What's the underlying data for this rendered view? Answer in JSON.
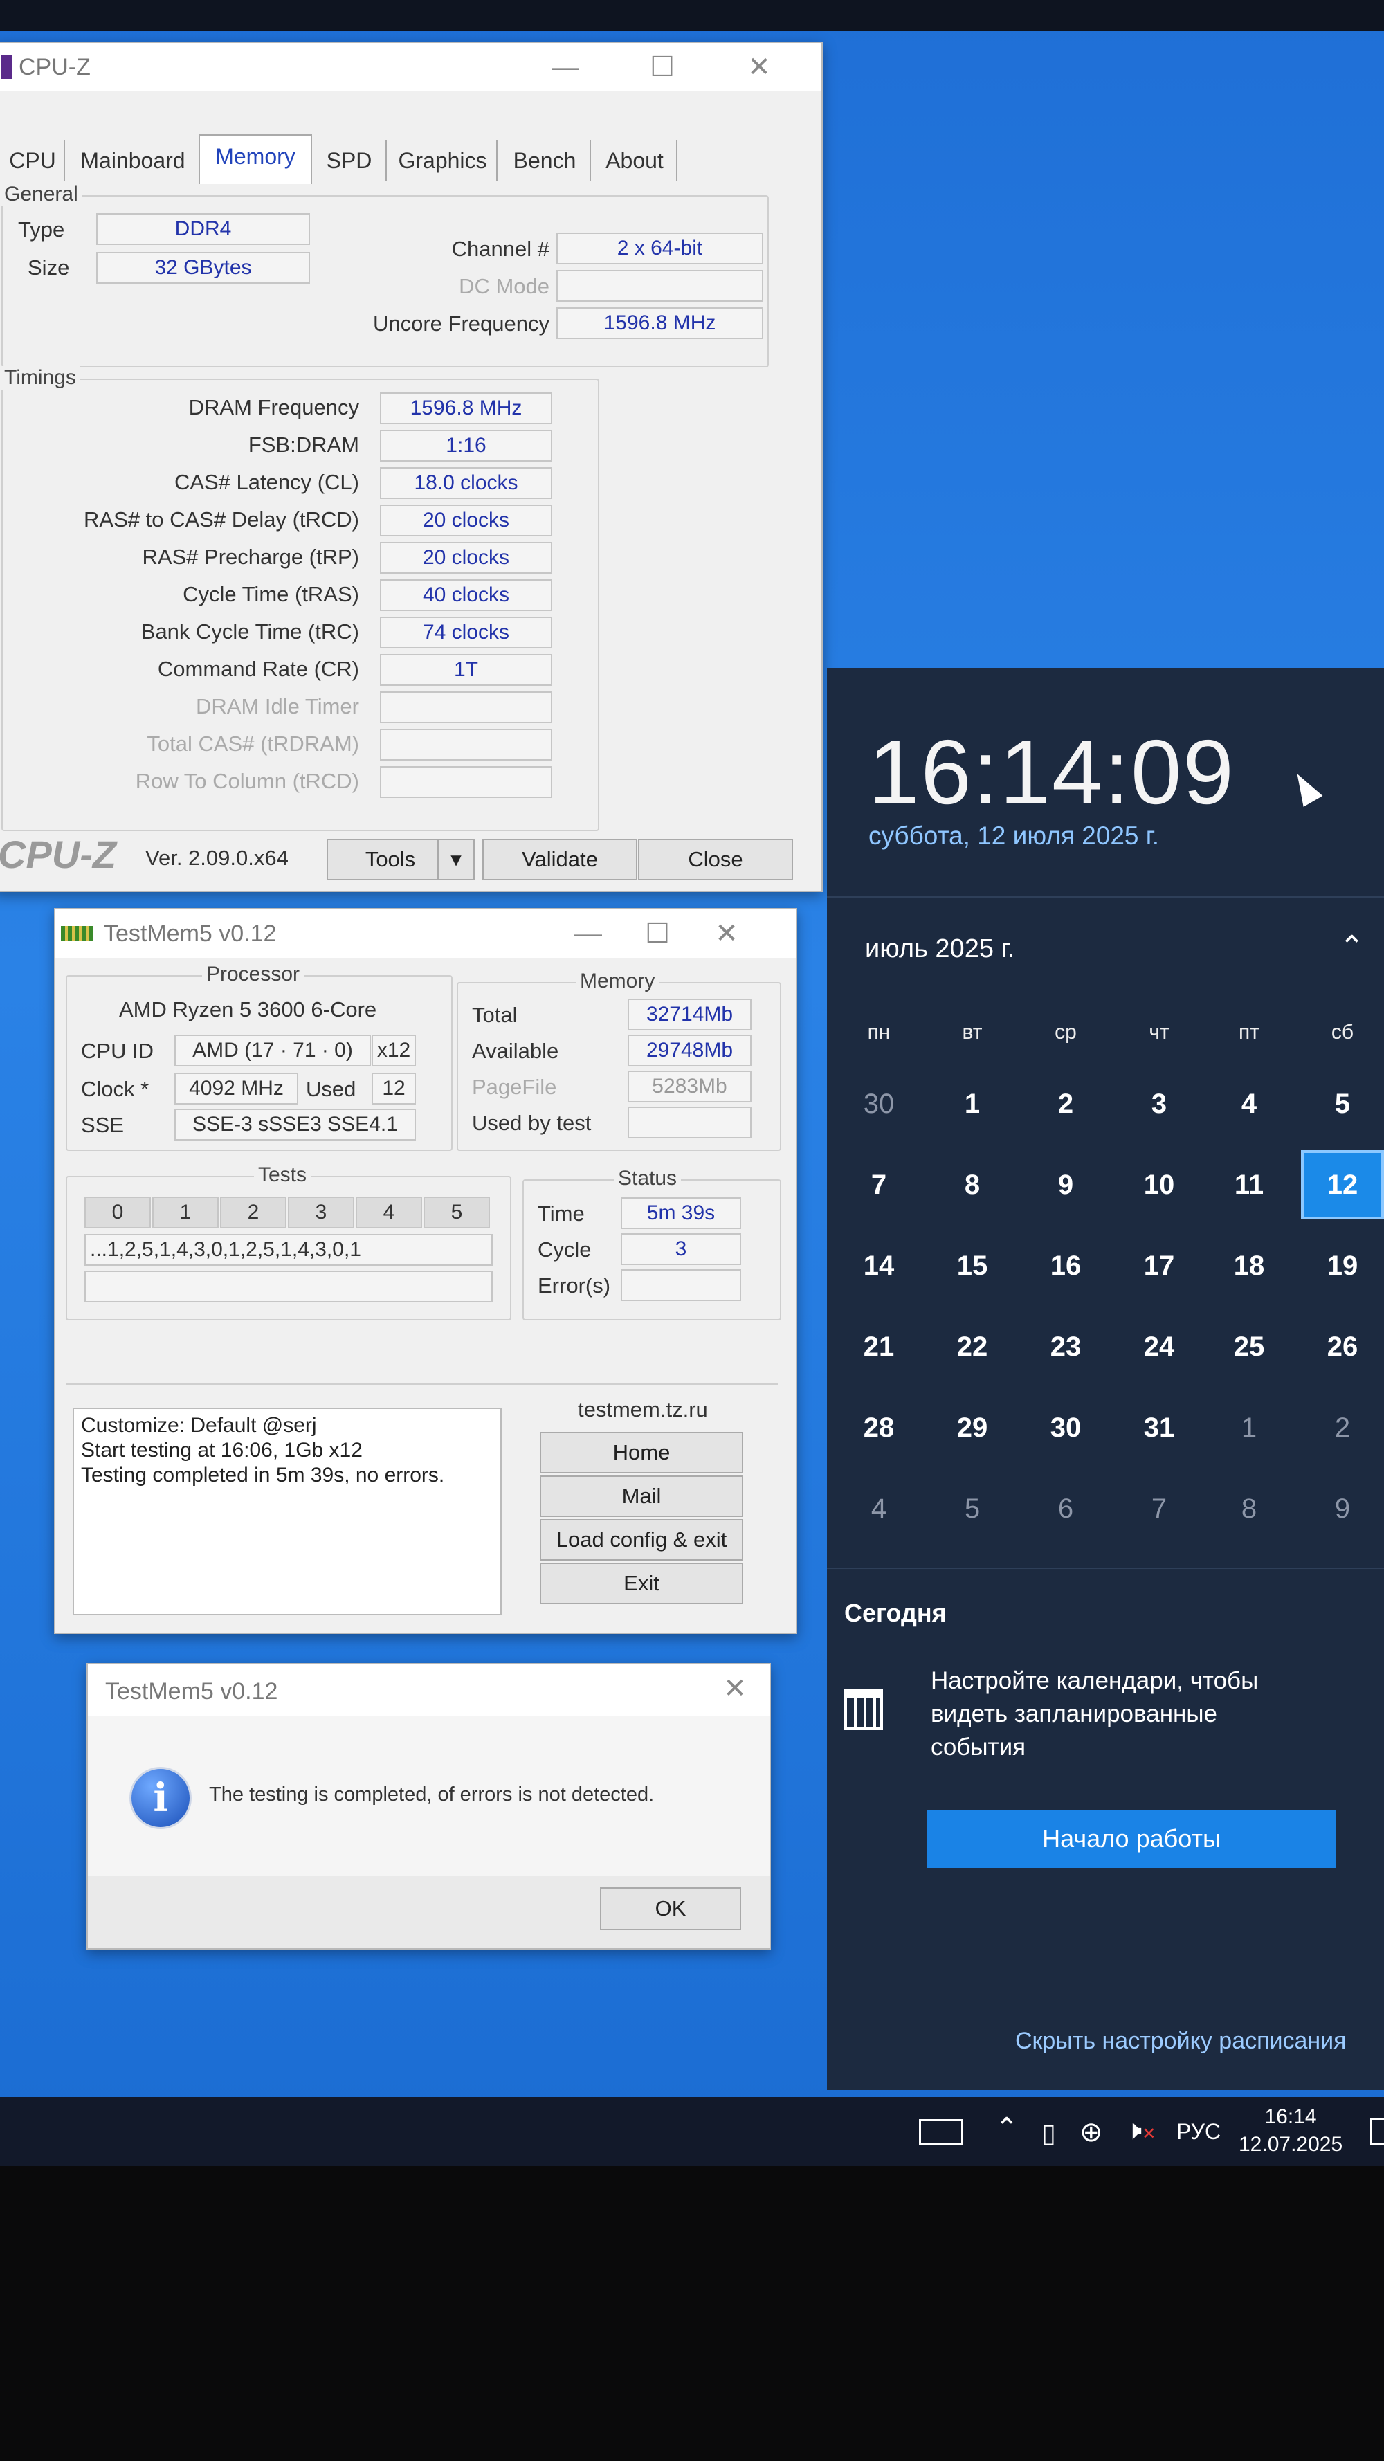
{
  "cpuz": {
    "title": "CPU-Z",
    "tabs": [
      "CPU",
      "Mainboard",
      "Memory",
      "SPD",
      "Graphics",
      "Bench",
      "About"
    ],
    "general_title": "General",
    "type_label": "Type",
    "type_value": "DDR4",
    "size_label": "Size",
    "size_value": "32 GBytes",
    "channel_label": "Channel #",
    "channel_value": "2 x 64-bit",
    "dcmode_label": "DC Mode",
    "dcmode_value": "",
    "uncore_label": "Uncore Frequency",
    "uncore_value": "1596.8 MHz",
    "timings_title": "Timings",
    "timings": [
      {
        "label": "DRAM Frequency",
        "value": "1596.8 MHz",
        "dim": false
      },
      {
        "label": "FSB:DRAM",
        "value": "1:16",
        "dim": false
      },
      {
        "label": "CAS# Latency (CL)",
        "value": "18.0 clocks",
        "dim": false
      },
      {
        "label": "RAS# to CAS# Delay (tRCD)",
        "value": "20 clocks",
        "dim": false
      },
      {
        "label": "RAS# Precharge (tRP)",
        "value": "20 clocks",
        "dim": false
      },
      {
        "label": "Cycle Time (tRAS)",
        "value": "40 clocks",
        "dim": false
      },
      {
        "label": "Bank Cycle Time (tRC)",
        "value": "74 clocks",
        "dim": false
      },
      {
        "label": "Command Rate (CR)",
        "value": "1T",
        "dim": false
      },
      {
        "label": "DRAM Idle Timer",
        "value": "",
        "dim": true
      },
      {
        "label": "Total CAS# (tRDRAM)",
        "value": "",
        "dim": true
      },
      {
        "label": "Row To Column (tRCD)",
        "value": "",
        "dim": true
      }
    ],
    "logo": "CPU-Z",
    "version": "Ver. 2.09.0.x64",
    "tools_label": "Tools",
    "validate_label": "Validate",
    "close_label": "Close"
  },
  "testmem": {
    "title": "TestMem5 v0.12",
    "processor_title": "Processor",
    "cpu_name": "AMD Ryzen 5 3600 6-Core",
    "cpuid_label": "CPU ID",
    "cpuid_value": "AMD  (17 · 71 · 0)",
    "cpuid_x": "x12",
    "clock_label": "Clock *",
    "clock_value": "4092 MHz",
    "used_label": "Used",
    "used_value": "12",
    "sse_label": "SSE",
    "sse_value": "SSE-3 sSSE3 SSE4.1",
    "memory_title": "Memory",
    "total_label": "Total",
    "total_value": "32714Mb",
    "available_label": "Available",
    "available_value": "29748Mb",
    "pagefile_label": "PageFile",
    "pagefile_value": "5283Mb",
    "usedbytest_label": "Used by test",
    "usedbytest_value": "",
    "tests_title": "Tests",
    "test_ids": [
      "0",
      "1",
      "2",
      "3",
      "4",
      "5"
    ],
    "sequence": "...1,2,5,1,4,3,0,1,2,5,1,4,3,0,1",
    "status_title": "Status",
    "time_label": "Time",
    "time_value": "5m 39s",
    "cycle_label": "Cycle",
    "cycle_value": "3",
    "errors_label": "Error(s)",
    "errors_value": "",
    "log_lines": [
      "Customize: Default @serj",
      "Start testing at 16:06, 1Gb x12",
      "Testing completed in 5m 39s, no errors."
    ],
    "site": "testmem.tz.ru",
    "home_label": "Home",
    "mail_label": "Mail",
    "load_label": "Load config & exit",
    "exit_label": "Exit"
  },
  "dialog": {
    "title": "TestMem5 v0.12",
    "message": "The testing is completed, of errors is not detected.",
    "ok_label": "OK"
  },
  "calendar": {
    "time": "16:14:09",
    "date_long": "суббота, 12 июля 2025 г.",
    "month_label": "июль 2025 г.",
    "weekdays": [
      "пн",
      "вт",
      "ср",
      "чт",
      "пт",
      "сб"
    ],
    "rows": [
      [
        "30",
        "1",
        "2",
        "3",
        "4",
        "5"
      ],
      [
        "7",
        "8",
        "9",
        "10",
        "11",
        "12"
      ],
      [
        "14",
        "15",
        "16",
        "17",
        "18",
        "19"
      ],
      [
        "21",
        "22",
        "23",
        "24",
        "25",
        "26"
      ],
      [
        "28",
        "29",
        "30",
        "31",
        "1",
        "2"
      ],
      [
        "4",
        "5",
        "6",
        "7",
        "8",
        "9"
      ]
    ],
    "today_label": "Сегодня",
    "promo_text": "Настройте календари, чтобы видеть запланированные события",
    "start_button": "Начало работы",
    "hide_link": "Скрыть настройку расписания"
  },
  "taskbar": {
    "lang": "РУС",
    "time": "16:14",
    "date": "12.07.2025"
  }
}
